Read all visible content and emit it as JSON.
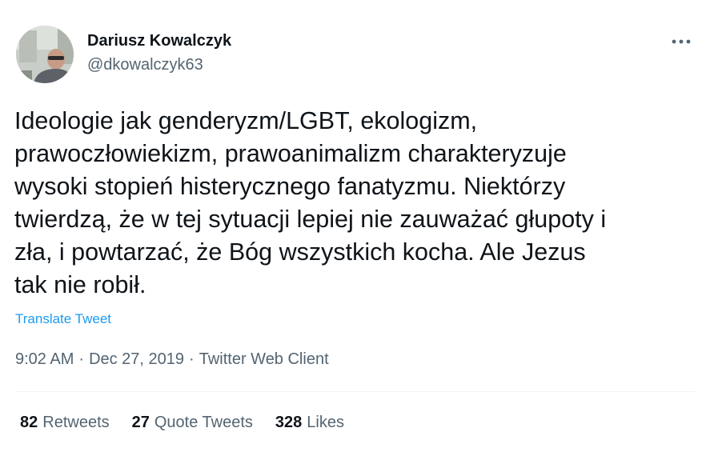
{
  "author": {
    "name": "Dariusz Kowalczyk",
    "handle": "@dkowalczyk63"
  },
  "tweet": {
    "lines": [
      "Ideologie jak genderyzm/LGBT, ekologizm,",
      "prawoczłowiekizm, prawoanimalizm charakteryzuje",
      "wysoki stopień histerycznego fanatyzmu. Niektórzy",
      "twierdzą, że w tej sytuacji lepiej nie zauważać głupoty i",
      "zła, i powtarzać, że Bóg wszystkich kocha. Ale Jezus",
      "tak nie robił."
    ],
    "translate_label": "Translate Tweet"
  },
  "meta": {
    "time": "9:02 AM",
    "separator": "·",
    "date": "Dec 27, 2019",
    "client": "Twitter Web Client"
  },
  "stats": {
    "retweets_count": "82",
    "retweets_label": "Retweets",
    "quote_count": "27",
    "quote_label": "Quote Tweets",
    "likes_count": "328",
    "likes_label": "Likes"
  },
  "icons": {
    "more": "more-horizontal-icon"
  },
  "colors": {
    "text": "#0f1419",
    "secondary": "#536471",
    "link": "#1d9bf0",
    "divider": "#eff3f4"
  }
}
